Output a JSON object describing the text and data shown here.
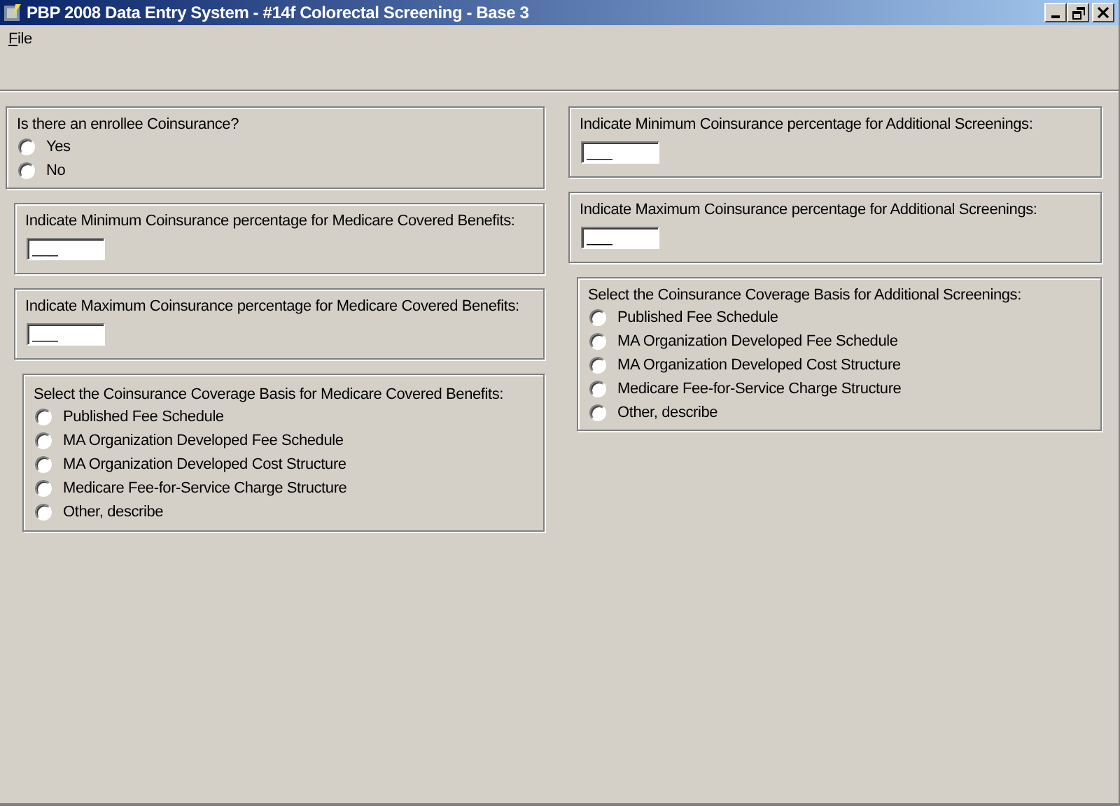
{
  "window": {
    "title": "PBP 2008 Data Entry System - #14f Colorectal Screening - Base 3"
  },
  "menu": [
    {
      "label": "F",
      "rest": "ile"
    }
  ],
  "columns": [
    {
      "groups": [
        {
          "kind": "radio",
          "label": "Is there an enrollee Coinsurance?",
          "options": [
            {
              "label": "Yes",
              "selected": false
            },
            {
              "label": "No",
              "selected": false
            }
          ]
        },
        {
          "kind": "field",
          "label": "Indicate Minimum Coinsurance percentage for Medicare Covered Benefits:",
          "value": "___"
        },
        {
          "kind": "field",
          "label": "Indicate Maximum Coinsurance percentage for Medicare Covered Benefits:",
          "value": "___"
        },
        {
          "kind": "radio",
          "label": "Select the Coinsurance Coverage Basis for Medicare Covered Benefits:",
          "options": [
            {
              "label": "Published Fee Schedule",
              "selected": false
            },
            {
              "label": "MA Organization Developed Fee Schedule",
              "selected": false
            },
            {
              "label": "MA Organization Developed Cost Structure",
              "selected": false
            },
            {
              "label": "Medicare Fee-for-Service Charge Structure",
              "selected": false
            },
            {
              "label": "Other, describe",
              "selected": false
            }
          ]
        }
      ]
    },
    {
      "groups": [
        {
          "kind": "field",
          "label": "Indicate Minimum Coinsurance percentage for Additional Screenings:",
          "value": "___"
        },
        {
          "kind": "field",
          "label": "Indicate Maximum Coinsurance percentage for Additional Screenings:",
          "value": "___"
        },
        {
          "kind": "radio",
          "label": "Select the Coinsurance Coverage Basis for Additional Screenings:",
          "options": [
            {
              "label": "Published Fee Schedule",
              "selected": false
            },
            {
              "label": "MA Organization Developed Fee Schedule",
              "selected": false
            },
            {
              "label": "MA Organization Developed Cost Structure",
              "selected": false
            },
            {
              "label": "Medicare Fee-for-Service Charge Structure",
              "selected": false
            },
            {
              "label": "Other, describe",
              "selected": false
            }
          ]
        }
      ]
    }
  ]
}
